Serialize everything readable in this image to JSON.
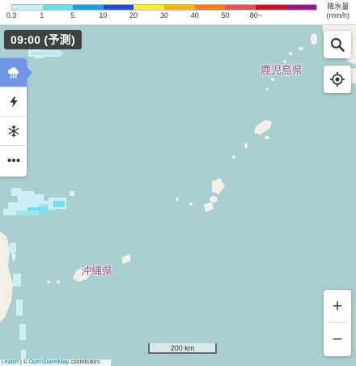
{
  "legend": {
    "colors": [
      "#c4f2ff",
      "#62dcef",
      "#1e9ee0",
      "#1a50c8",
      "#ffee22",
      "#ffb300",
      "#ff7a1f",
      "#ea4f5a",
      "#cc1020",
      "#96148c"
    ],
    "ticks": [
      "0.3",
      "1",
      "5",
      "10",
      "20",
      "30",
      "40",
      "50",
      "80~"
    ],
    "title_line1": "降水量",
    "title_line2": "(mm/h)"
  },
  "time_badge": "09:00 (予測)",
  "layers": {
    "items": [
      {
        "name": "rain",
        "icon": "rain-cloud-icon",
        "active": true
      },
      {
        "name": "lightning",
        "icon": "lightning-icon",
        "active": false
      },
      {
        "name": "snow",
        "icon": "snowflake-icon",
        "active": false
      },
      {
        "name": "more",
        "icon": "more-dots-icon",
        "active": false
      }
    ]
  },
  "controls": {
    "search_icon": "search-icon",
    "locate_icon": "crosshair-icon",
    "zoom_in": "+",
    "zoom_out": "−"
  },
  "map": {
    "labels": {
      "kagoshima": "鹿児島県",
      "okinawa": "沖縄県"
    },
    "scale_label": "200 km",
    "colors": {
      "sea": "#aacfcf",
      "land": "#f2efe9",
      "rain_light": "#cdeff5",
      "rain_medium": "#74dcea"
    }
  },
  "attribution": {
    "leaflet": "Leaflet",
    "separator": " | © ",
    "osm": "OpenStreetMap",
    "suffix": " contributors"
  }
}
